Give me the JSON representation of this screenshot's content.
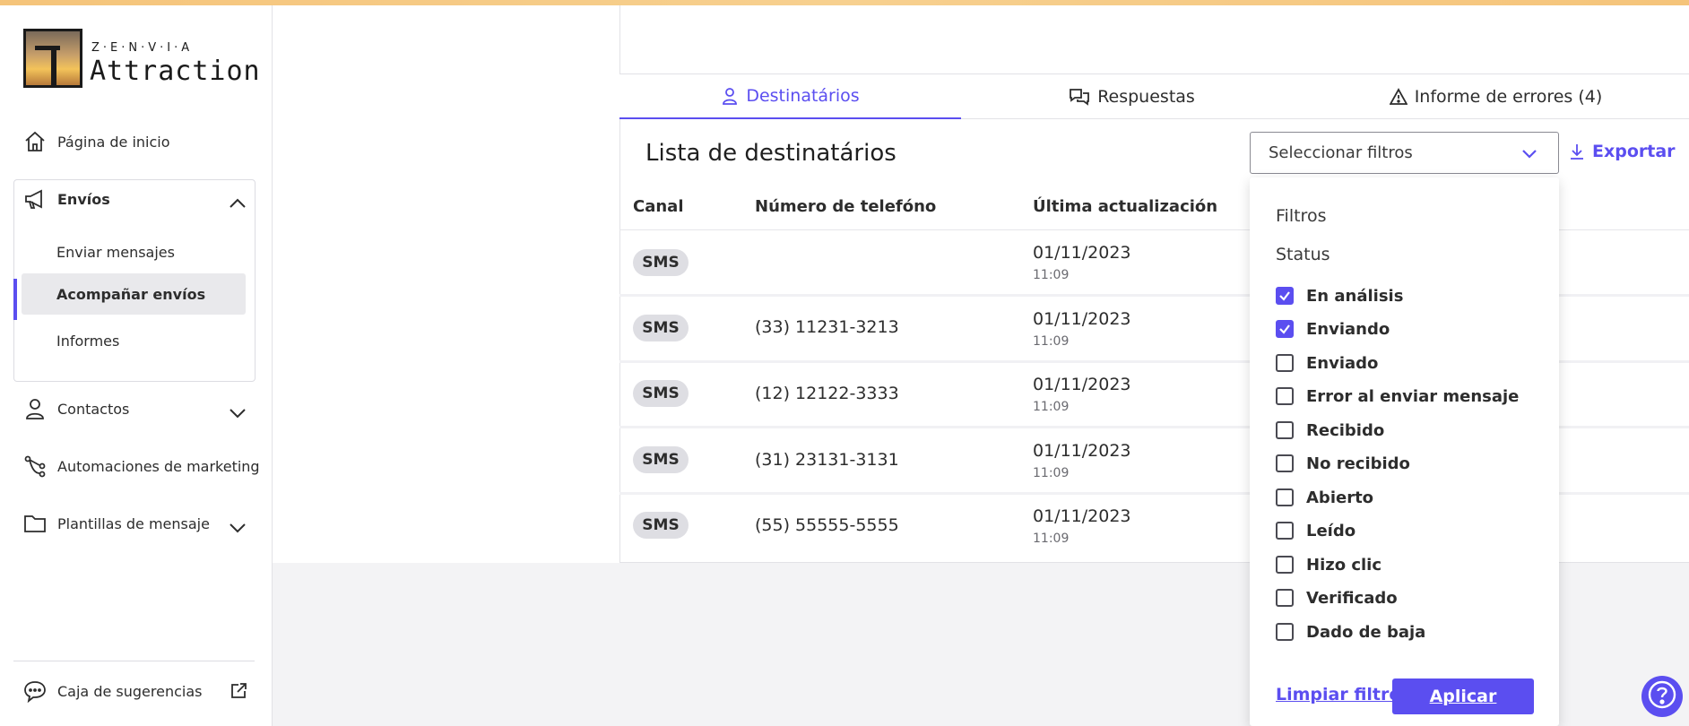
{
  "brand": {
    "top_small": "Z·E·N·V·I·A",
    "name": "Attraction"
  },
  "sidebar": {
    "home": "Página de inicio",
    "envios": {
      "label": "Envíos",
      "items": [
        "Enviar mensajes",
        "Acompañar envíos",
        "Informes"
      ],
      "active": "Acompañar envíos"
    },
    "contactos": "Contactos",
    "automaciones": "Automaciones de marketing",
    "plantillas": "Plantillas de mensaje",
    "sugerencias": "Caja de sugerencias"
  },
  "tabs": [
    {
      "label": "Destinatários",
      "active": true
    },
    {
      "label": "Respuestas",
      "active": false
    },
    {
      "label": "Informe de errores (4)",
      "active": false
    }
  ],
  "list": {
    "title": "Lista de destinatários",
    "filter_placeholder": "Seleccionar filtros",
    "export_label": "Exportar",
    "columns": [
      "Canal",
      "Número de telefóno",
      "Última actualización"
    ],
    "rows": [
      {
        "canal": "SMS",
        "phone": "",
        "date": "01/11/2023",
        "time": "11:09"
      },
      {
        "canal": "SMS",
        "phone": "(33) 11231-3213",
        "date": "01/11/2023",
        "time": "11:09"
      },
      {
        "canal": "SMS",
        "phone": "(12) 12122-3333",
        "date": "01/11/2023",
        "time": "11:09"
      },
      {
        "canal": "SMS",
        "phone": "(31) 23131-3131",
        "date": "01/11/2023",
        "time": "11:09"
      },
      {
        "canal": "SMS",
        "phone": "(55) 55555-5555",
        "date": "01/11/2023",
        "time": "11:09"
      }
    ]
  },
  "filters": {
    "title": "Filtros",
    "section": "Status",
    "options": [
      {
        "label": "En análisis",
        "checked": true
      },
      {
        "label": "Enviando",
        "checked": true
      },
      {
        "label": "Enviado",
        "checked": false
      },
      {
        "label": "Error al enviar mensaje",
        "checked": false
      },
      {
        "label": "Recibido",
        "checked": false
      },
      {
        "label": "No recibido",
        "checked": false
      },
      {
        "label": "Abierto",
        "checked": false
      },
      {
        "label": "Leído",
        "checked": false
      },
      {
        "label": "Hizo clic",
        "checked": false
      },
      {
        "label": "Verificado",
        "checked": false
      },
      {
        "label": "Dado de baja",
        "checked": false
      }
    ],
    "clear_label": "Limpiar filtros",
    "apply_label": "Aplicar"
  },
  "colors": {
    "accent": "#5b4ef0",
    "badge_bg": "#dedee3",
    "top_gradient": "#f5c47a"
  }
}
